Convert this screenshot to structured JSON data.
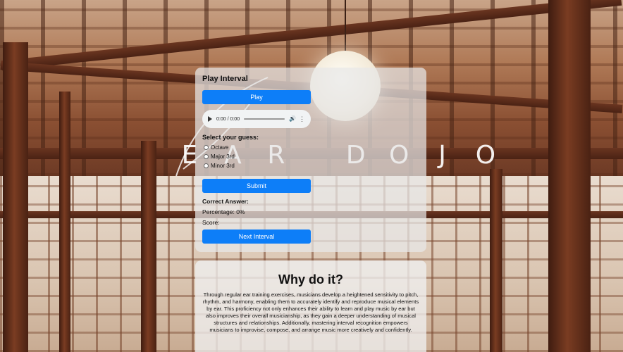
{
  "brand": {
    "letters": [
      "E",
      "A",
      "R",
      "D",
      "O",
      "J",
      "O"
    ]
  },
  "quiz": {
    "title": "Play Interval",
    "play_label": "Play",
    "audio": {
      "time": "0:00 / 0:00",
      "play_icon": "play-icon",
      "volume_icon": "volume-icon",
      "more_icon": "more-vertical-icon"
    },
    "guess_label": "Select your guess:",
    "options": [
      "Octave",
      "Major 3rd",
      "Minor 3rd"
    ],
    "submit_label": "Submit",
    "correct_label": "Correct Answer:",
    "percentage_text": "Percentage: 0%",
    "score_text": "Score:",
    "next_label": "Next Interval"
  },
  "info": {
    "heading": "Why do it?",
    "body": "Through regular ear training exercises, musicians develop a heightened sensitivity to pitch, rhythm, and harmony, enabling them to accurately identify and reproduce musical elements by ear. This proficiency not only enhances their ability to learn and play music by ear but also improves their overall musicianship, as they gain a deeper understanding of musical structures and relationships. Additionally, mastering interval recognition empowers musicians to improvise, compose, and arrange music more creatively and confidently."
  },
  "colors": {
    "accent": "#0d7ef8",
    "panel": "#e8e8e8"
  }
}
